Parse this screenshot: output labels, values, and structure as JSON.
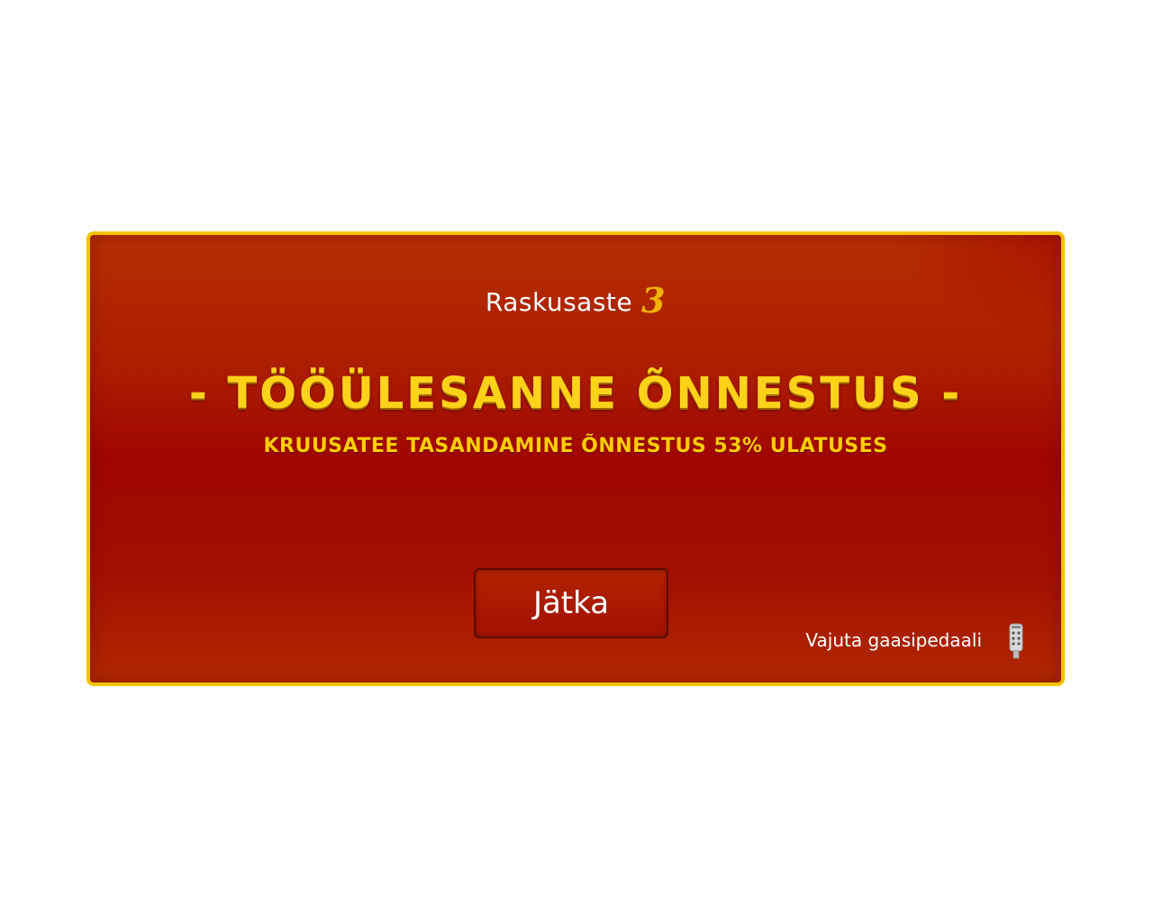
{
  "dialog": {
    "difficulty_label": "Raskusaste",
    "difficulty_level": "3",
    "title": "- TÖÖÜLESANNE ÕNNESTUS -",
    "subtitle": "KRUUSATEE TASANDAMINE ÕNNESTUS 53% ULATUSES",
    "continue_label": "Jätka",
    "hint": "Vajuta gaasipedaali",
    "hint_icon": "gas-pedal-icon"
  },
  "colors": {
    "border": "#f2c200",
    "background": "#a00600",
    "title": "#ffd21a",
    "accent_number": "#f2b400"
  }
}
